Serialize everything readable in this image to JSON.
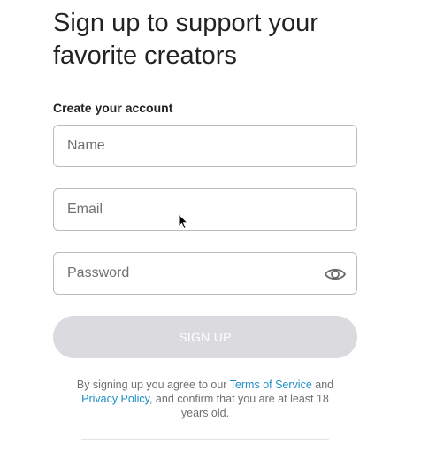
{
  "header": {
    "title_line1": "Sign up to support your",
    "title_line2": "favorite creators"
  },
  "form": {
    "section_label": "Create your account",
    "name": {
      "placeholder": "Name",
      "value": ""
    },
    "email": {
      "placeholder": "Email",
      "value": ""
    },
    "password": {
      "placeholder": "Password",
      "value": "",
      "toggle_icon": "eye-icon"
    },
    "submit_label": "SIGN UP",
    "submit_state": "disabled"
  },
  "legal": {
    "text_before_terms": "By signing up you agree to our ",
    "terms_link": "Terms of Service",
    "text_and": " and",
    "privacy_link": "Privacy Policy",
    "text_after": ", and confirm that you are at least 18 years old."
  },
  "colors": {
    "link": "#1d8fc8",
    "button_disabled_bg": "#dadadf",
    "field_border": "#bcbcbc"
  }
}
